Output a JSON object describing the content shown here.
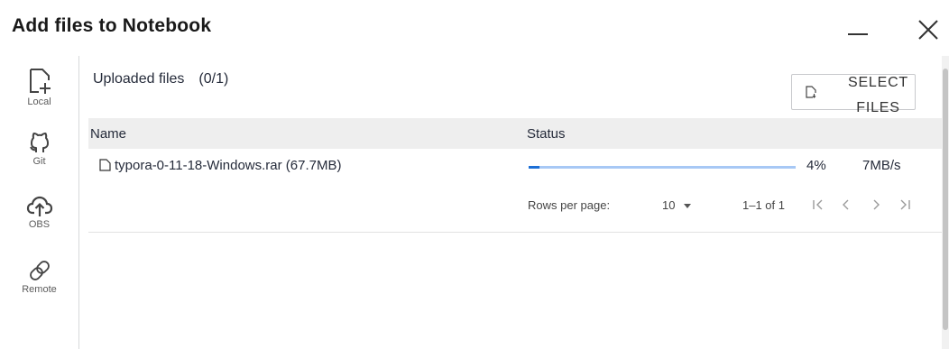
{
  "dialog": {
    "title": "Add files to Notebook"
  },
  "sidebar": {
    "items": [
      {
        "label": "Local",
        "icon": "file-plus-icon"
      },
      {
        "label": "Git",
        "icon": "github-icon"
      },
      {
        "label": "OBS",
        "icon": "cloud-upload-icon"
      },
      {
        "label": "Remote",
        "icon": "link-icon"
      }
    ]
  },
  "main": {
    "uploaded_label": "Uploaded files",
    "uploaded_count": "(0/1)",
    "select_button": "SELECT FILES"
  },
  "table": {
    "columns": [
      "Name",
      "Status"
    ],
    "rows": [
      {
        "name": "typora-0-11-18-Windows.rar (67.7MB)",
        "progress": 0.04,
        "percent": "4%",
        "speed": "7MB/s"
      }
    ]
  },
  "pagination": {
    "rows_per_page_label": "Rows per page:",
    "rows_per_page_value": "10",
    "range": "1–1 of 1"
  },
  "colors": {
    "progress_fill": "#1c6fd6",
    "progress_track": "#a7c8f5",
    "header_bg": "#eeeeee"
  }
}
